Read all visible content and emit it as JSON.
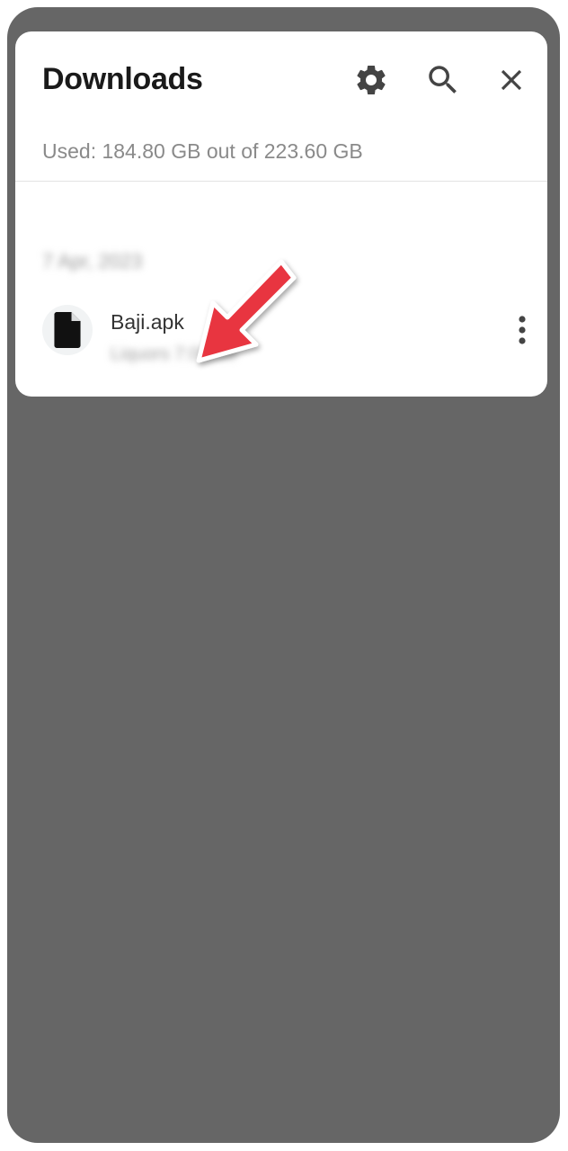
{
  "panel": {
    "title": "Downloads",
    "storage_text": "Used: 184.80 GB out of 223.60 GB",
    "date_header": "7 Apr, 2023",
    "icons": {
      "settings": "gear-icon",
      "search": "search-icon",
      "close": "close-icon"
    }
  },
  "files": [
    {
      "name": "Baji.apk",
      "meta": "Liquors 7:06AM",
      "icon": "file-icon",
      "menu_icon": "more-vert-icon"
    }
  ],
  "annotation": {
    "arrow_color": "#e8343f"
  },
  "colors": {
    "backdrop": "#666666",
    "panel": "#ffffff"
  }
}
